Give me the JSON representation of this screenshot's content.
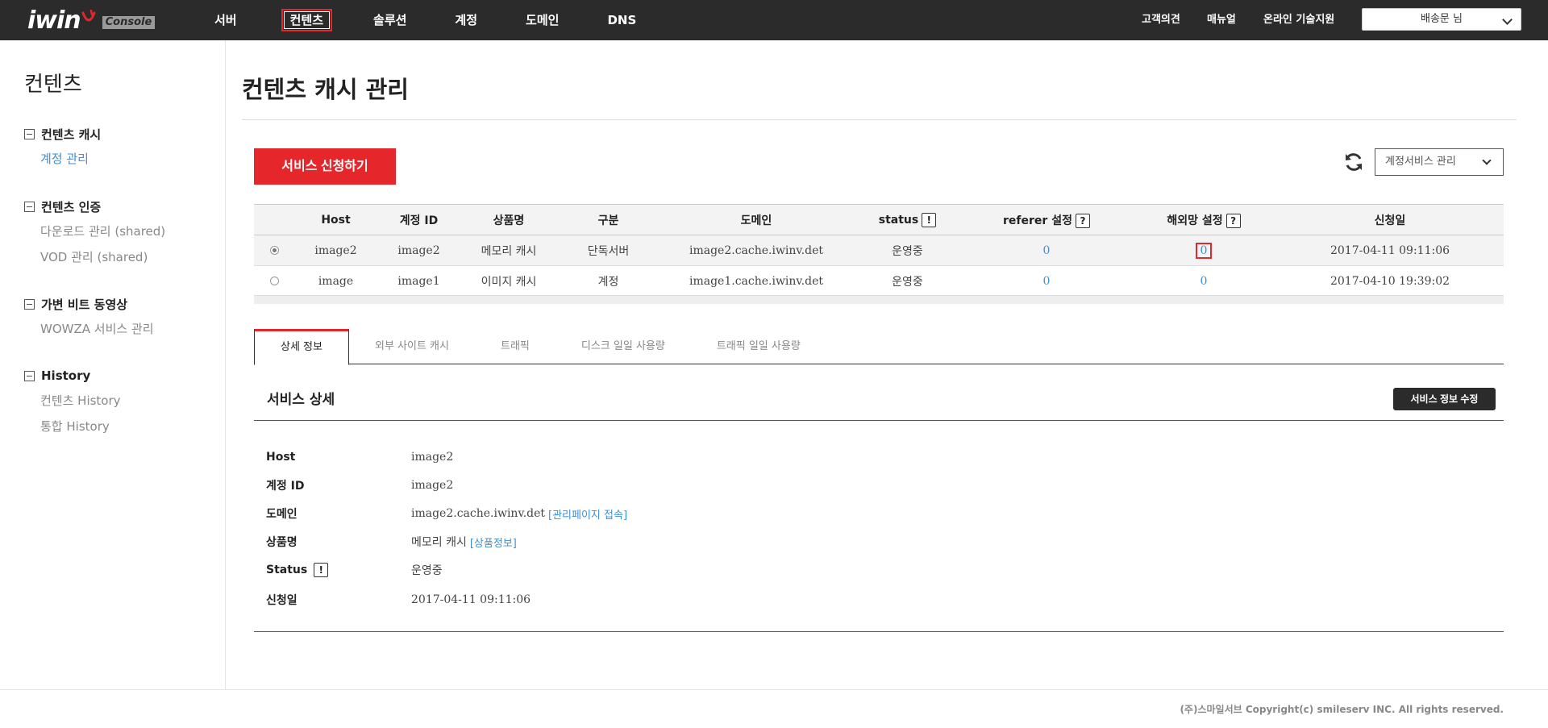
{
  "header": {
    "logo_text": "iwin",
    "logo_badge": "Console",
    "nav": [
      "서버",
      "컨텐츠",
      "솔루션",
      "계정",
      "도메인",
      "DNS"
    ],
    "util": [
      "고객의견",
      "매뉴얼",
      "온라인 기술지원"
    ],
    "user": "배송문 님"
  },
  "sidebar": {
    "title": "컨텐츠",
    "groups": [
      {
        "label": "컨텐츠 캐시",
        "items": [
          "계정 관리"
        ]
      },
      {
        "label": "컨텐츠 인증",
        "items": [
          "다운로드 관리 (shared)",
          "VOD 관리 (shared)"
        ]
      },
      {
        "label": "가변 비트 동영상",
        "items": [
          "WOWZA 서비스 관리"
        ]
      },
      {
        "label": "History",
        "items": [
          "컨텐츠 History",
          "통합 History"
        ]
      }
    ]
  },
  "main": {
    "title": "컨텐츠 캐시 관리",
    "apply_button": "서비스 신청하기",
    "service_select": "계정서비스 관리",
    "table": {
      "headers": [
        "Host",
        "계정 ID",
        "상품명",
        "구분",
        "도메인",
        "status",
        "referer 설정",
        "해외망 설정",
        "신청일"
      ],
      "header_marks": {
        "status": "!",
        "referer": "?",
        "overseas": "?"
      },
      "rows": [
        {
          "host": "image2",
          "id": "image2",
          "product": "메모리 캐시",
          "type": "단독서버",
          "domain": "image2.cache.iwinv.det",
          "status": "운영중",
          "referer": "0",
          "overseas": "0",
          "date": "2017-04-11 09:11:06"
        },
        {
          "host": "image",
          "id": "image1",
          "product": "이미지 캐시",
          "type": "계정",
          "domain": "image1.cache.iwinv.det",
          "status": "운영중",
          "referer": "0",
          "overseas": "0",
          "date": "2017-04-10 19:39:02"
        }
      ]
    },
    "tabs": [
      "상세 정보",
      "외부 사이트 캐시",
      "트래픽",
      "디스크 일일 사용량",
      "트래픽 일일 사용량"
    ],
    "detail": {
      "title": "서비스 상세",
      "edit_button": "서비스 정보 수정",
      "rows": [
        {
          "label": "Host",
          "value": "image2"
        },
        {
          "label": "계정 ID",
          "value": "image2"
        },
        {
          "label": "도메인",
          "value": "image2.cache.iwinv.det",
          "link": "[관리페이지 접속]"
        },
        {
          "label": "상품명",
          "value": "메모리 캐시",
          "link": "[상품정보]"
        },
        {
          "label": "Status",
          "mark": "!",
          "value": "운영중"
        },
        {
          "label": "신청일",
          "value": "2017-04-11 09:11:06"
        }
      ]
    }
  },
  "footer": {
    "copyright": "(주)스마일서브 Copyright(c) smileserv INC. All rights reserved."
  },
  "colors": {
    "accent": "#e5262a",
    "link": "#3d8fd6",
    "topbar": "#2b2b2b"
  }
}
